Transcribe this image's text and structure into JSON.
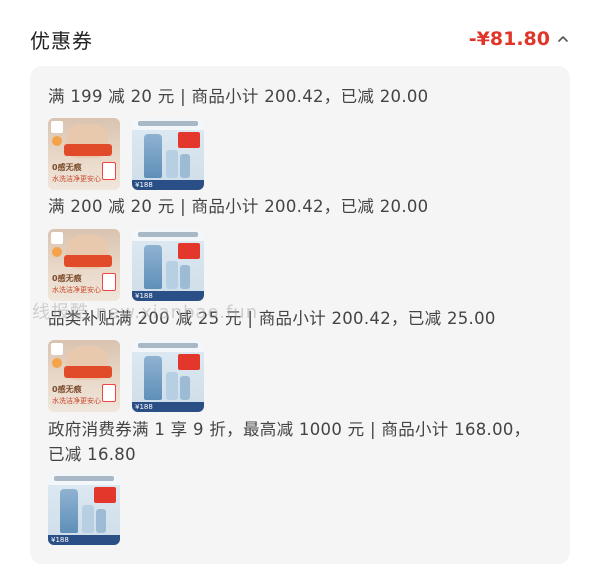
{
  "header": {
    "title": "优惠券",
    "amount": "-¥81.80"
  },
  "coupons": [
    {
      "text": "满 199 减 20 元 | 商品小计 200.42，已减 20.00"
    },
    {
      "text": "满 200 减 20 元 | 商品小计 200.42，已减 20.00"
    },
    {
      "text": "品类补贴满 200 减 25 元 | 商品小计 200.42，已减 25.00"
    },
    {
      "text": "政府消费券满 1 享 9 折，最高减 1000 元 | 商品小计 168.00，已减 16.80"
    }
  ],
  "thumbs": {
    "underwear_line1": "0感无痕",
    "underwear_line2": "水洗洁净更安心",
    "shampoo_price": "¥188"
  },
  "watermark": "线报酷 new.xianbao.fun"
}
